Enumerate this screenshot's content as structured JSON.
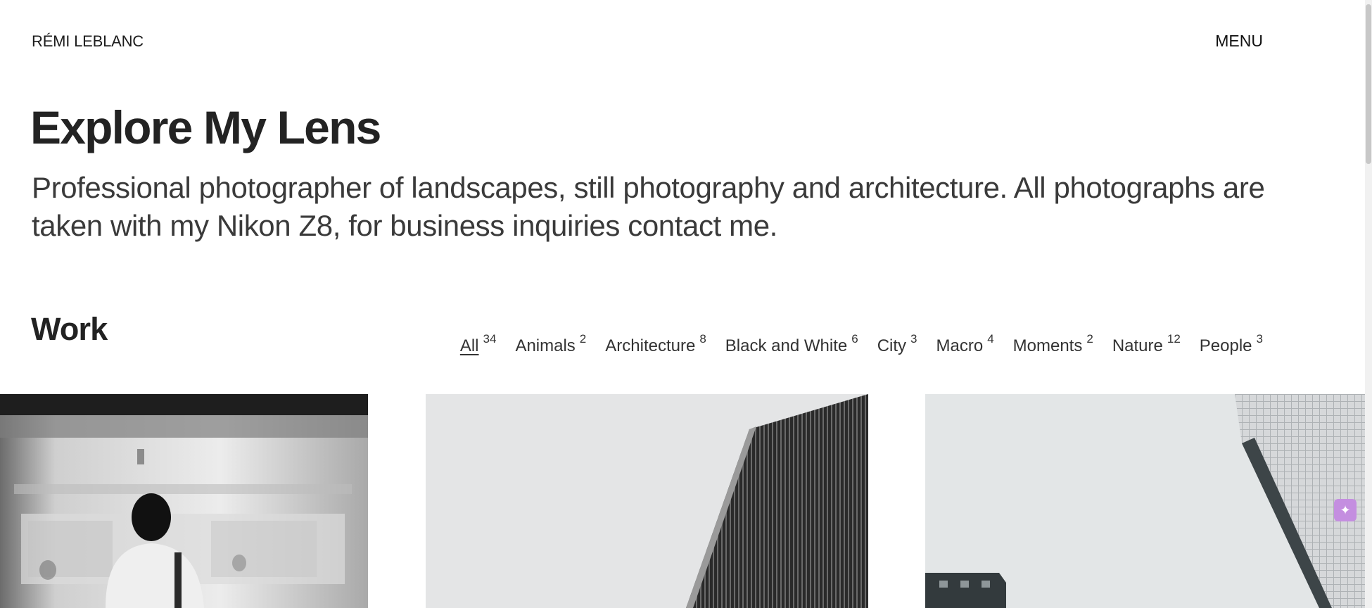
{
  "header": {
    "brand": "RÉMI LEBLANC",
    "menu_label": "MENU"
  },
  "hero": {
    "title": "Explore My Lens",
    "description": "Professional photographer of landscapes, still photography and architecture. All photographs are taken with my Nikon Z8, for business inquiries contact me."
  },
  "work": {
    "title": "Work",
    "filters": [
      {
        "label": "All",
        "count": "34",
        "active": true
      },
      {
        "label": "Animals",
        "count": "2"
      },
      {
        "label": "Architecture",
        "count": "8"
      },
      {
        "label": "Black and White",
        "count": "6"
      },
      {
        "label": "City",
        "count": "3"
      },
      {
        "label": "Macro",
        "count": "4"
      },
      {
        "label": "Moments",
        "count": "2"
      },
      {
        "label": "Nature",
        "count": "12"
      },
      {
        "label": "People",
        "count": "3"
      }
    ]
  },
  "gallery": {
    "photos": [
      {
        "subject": "woman-in-subway-station-photo"
      },
      {
        "subject": "dark-striped-building-photo"
      },
      {
        "subject": "tall-white-tiled-tower-photo"
      }
    ]
  },
  "colors": {
    "text": "#1f1f1f",
    "muted_text": "#3a3a3a",
    "background": "#ffffff",
    "assistant_accent": "#c48ee0"
  },
  "icons": {
    "assistant": "sparkle-icon"
  }
}
